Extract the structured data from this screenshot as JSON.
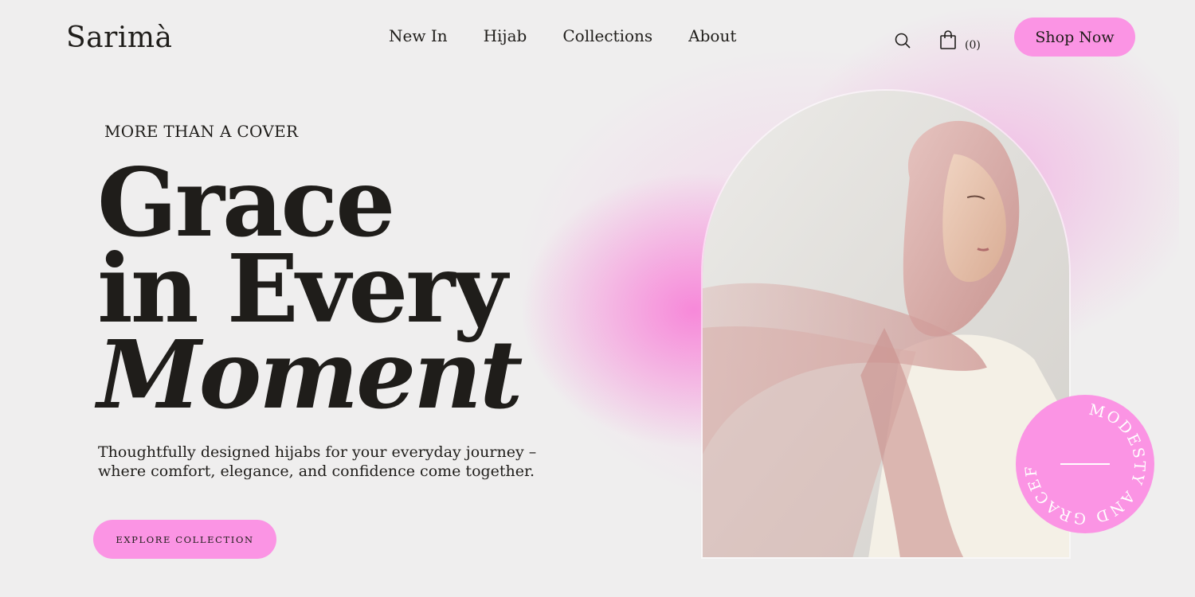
{
  "brand": {
    "name": "Sarimà"
  },
  "nav": {
    "items": [
      {
        "label": "New In"
      },
      {
        "label": "Hijab"
      },
      {
        "label": "Collections"
      },
      {
        "label": "About"
      }
    ]
  },
  "header": {
    "search_icon": "search-icon",
    "cart_icon": "shopping-bag-icon",
    "cart_count": "(0)",
    "cta_label": "Shop Now"
  },
  "hero": {
    "eyebrow": "MORE THAN A COVER",
    "headline": {
      "line1": "Grace",
      "line2": "in Every",
      "line3": "Moment"
    },
    "subtitle_line1": "Thoughtfully designed hijabs for your everyday journey –",
    "subtitle_line2": "where comfort, elegance, and confidence come together.",
    "cta_label": "EXPLORE COLLECTION"
  },
  "badge": {
    "text": "MODESTY AND GRACEFULNESS"
  },
  "colors": {
    "accent_pink": "#fb94e4",
    "background": "#efeeee",
    "text": "#1f1d1a",
    "glow_pink": "#f87ad6"
  }
}
